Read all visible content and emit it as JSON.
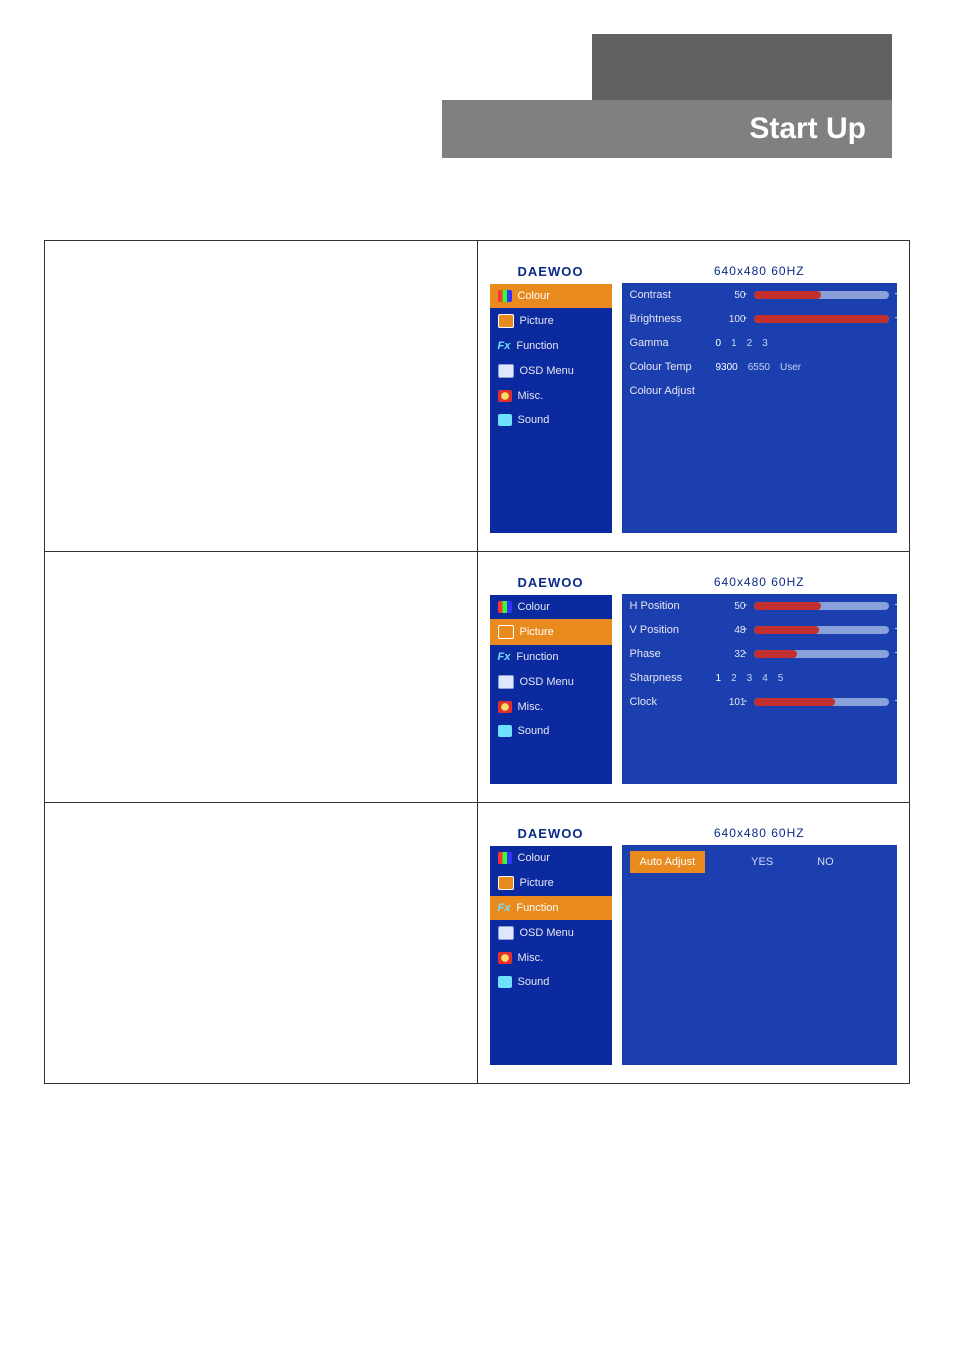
{
  "header": {
    "title": "Start Up"
  },
  "menu": {
    "brand": "DAEWOO",
    "items": [
      {
        "key": "colour",
        "label": "Colour"
      },
      {
        "key": "picture",
        "label": "Picture"
      },
      {
        "key": "function",
        "label": "Function"
      },
      {
        "key": "osdmenu",
        "label": "OSD Menu"
      },
      {
        "key": "misc",
        "label": "Misc."
      },
      {
        "key": "sound",
        "label": "Sound"
      }
    ]
  },
  "resolution": "640x480  60HZ",
  "panel1": {
    "selected": "colour",
    "contrast": {
      "label": "Contrast",
      "value": "50"
    },
    "brightness": {
      "label": "Brightness",
      "value": "100"
    },
    "gamma": {
      "label": "Gamma",
      "options": [
        "0",
        "1",
        "2",
        "3"
      ],
      "selected": "0"
    },
    "colourtemp": {
      "label": "Colour Temp",
      "options": [
        "9300",
        "6550",
        "User"
      ],
      "selected": "9300"
    },
    "colouradjust": {
      "label": "Colour Adjust"
    }
  },
  "panel2": {
    "selected": "picture",
    "hpos": {
      "label": "H Position",
      "value": "50"
    },
    "vpos": {
      "label": "V Position",
      "value": "48"
    },
    "phase": {
      "label": "Phase",
      "value": "32"
    },
    "sharpness": {
      "label": "Sharpness",
      "options": [
        "1",
        "2",
        "3",
        "4",
        "5"
      ],
      "selected": "1"
    },
    "clock": {
      "label": "Clock",
      "value": "101"
    }
  },
  "panel3": {
    "selected": "function",
    "autoadjust": {
      "label": "Auto Adjust",
      "yes": "YES",
      "no": "NO"
    }
  }
}
